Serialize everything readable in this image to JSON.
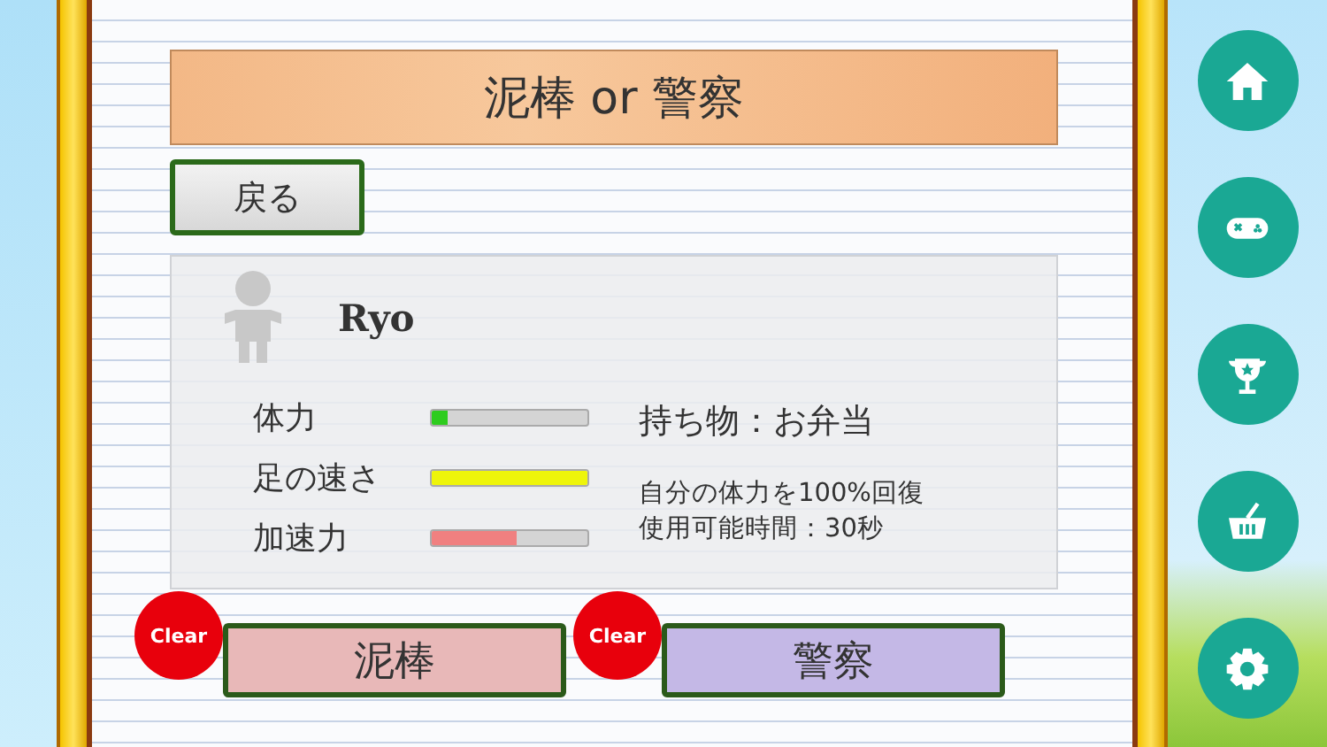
{
  "title": "泥棒 or 警察",
  "back_button": "戻る",
  "character": {
    "name": "Ryo",
    "stats": [
      {
        "label": "体力",
        "level": 0.1,
        "color": "#2ecc1e"
      },
      {
        "label": "足の速さ",
        "level": 1.0,
        "color": "#eef50a"
      },
      {
        "label": "加速力",
        "level": 0.55,
        "color": "#f08080"
      }
    ],
    "item": "持ち物：お弁当",
    "item_description": [
      "自分の体力を100%回復",
      "使用可能時間：30秒"
    ]
  },
  "roles": [
    {
      "label": "泥棒",
      "badge": "Clear",
      "color": "#e8b8b8"
    },
    {
      "label": "警察",
      "badge": "Clear",
      "color": "#c4b8e6"
    }
  ],
  "nav": [
    {
      "kind": "home"
    },
    {
      "kind": "game"
    },
    {
      "kind": "trophy"
    },
    {
      "kind": "basket"
    },
    {
      "kind": "settings"
    }
  ]
}
